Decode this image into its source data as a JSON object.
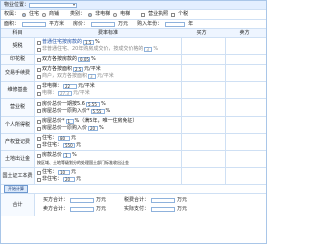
{
  "header": {
    "location_label": "物业位置："
  },
  "top": {
    "nature_label": "权属：",
    "nature_options": [
      "住宅",
      "商铺"
    ],
    "nature_selected": 0,
    "type_label": "类别：",
    "type_options": [
      "非电梯",
      "电梯"
    ],
    "type_selected": 0,
    "extra_options": [
      "营业执照",
      "个税"
    ],
    "area_label": "面积：",
    "area_unit": "平方米",
    "price_label": "房价：",
    "price_unit": "万元",
    "years_label": "购入年份：",
    "years_unit": "年"
  },
  "columns": [
    "科目",
    "费率标准",
    "买方",
    "卖方"
  ],
  "sections": [
    {
      "name": "契税",
      "lines": [
        "普通住宅按房款的",
        "1.5",
        "%",
        "非普通住宅、20年购房成交价，按成交价格的",
        "3",
        "%"
      ]
    },
    {
      "name": "印花税",
      "lines": [
        "双方各按房款的",
        "0.05",
        "%"
      ]
    },
    {
      "name": "交易手续费",
      "lines": [
        "双方各按面积",
        "2.5",
        "元/平米",
        "商户，双方各按面积",
        "3",
        "元/平米"
      ]
    },
    {
      "name": "维修基金",
      "lines": [
        "非电梯：",
        "22",
        "元/平米",
        "电梯：",
        "27.3",
        "元/平米"
      ]
    },
    {
      "name": "营业税",
      "lines": [
        "房价总价一期按5.6",
        "5.55",
        "%",
        "房屋总价一原购入价*",
        "5.55",
        "%"
      ]
    },
    {
      "name": "个人所得税",
      "lines": [
        "房屋总价*",
        "1",
        "%（满5年，唯一住房免征）",
        "房屋总价一原购入价",
        "20",
        "%"
      ]
    },
    {
      "name": "产权登记费",
      "lines": [
        "住宅：",
        "80",
        "元",
        "非住宅：",
        "550",
        "元"
      ]
    },
    {
      "name": "土地出让金",
      "lines": [
        "房款总价",
        "1",
        "%",
        "按区域、土地等级划分的处理国土部门标准收出让金"
      ]
    },
    {
      "name": "国土证工本费",
      "lines": [
        "住宅：",
        "10",
        "元",
        "非住宅：",
        "20",
        "元"
      ]
    }
  ],
  "calc_button": "开始计算",
  "totals": {
    "label": "合计",
    "buyer_label": "买方合计：",
    "buyer_unit": "万元",
    "seller_label": "卖方合计：",
    "seller_unit": "万元",
    "tax_label": "税费合计：",
    "tax_unit": "万元",
    "total_label": "实际支付：",
    "total_unit": "万元"
  }
}
